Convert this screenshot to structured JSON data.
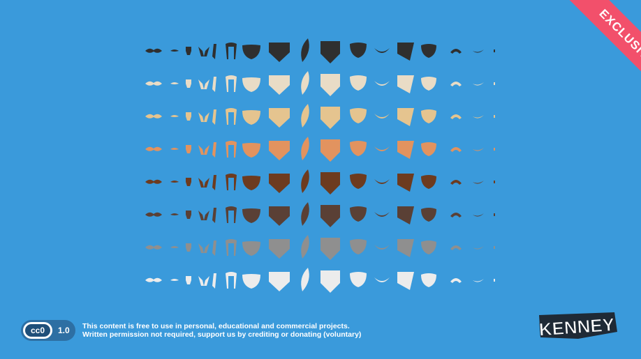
{
  "ribbon": {
    "label": "EXCLUSIVE",
    "color": "#f2506b"
  },
  "background_color": "#3a9adb",
  "sprite_sheet": {
    "rows": 8,
    "columns": 18,
    "row_colors": [
      "#2f2f2f",
      "#e9dcc6",
      "#e5c48f",
      "#e2935f",
      "#6d3b1f",
      "#5a4035",
      "#8f8f8f",
      "#ececec"
    ]
  },
  "license": {
    "badge_text": "cc0",
    "version": "1.0",
    "line1": "This content is free to use in personal, educational and commercial projects.",
    "line2": "Written permission not required, support us by crediting or donating (voluntary)"
  },
  "logo": {
    "text": "KENNEY"
  }
}
